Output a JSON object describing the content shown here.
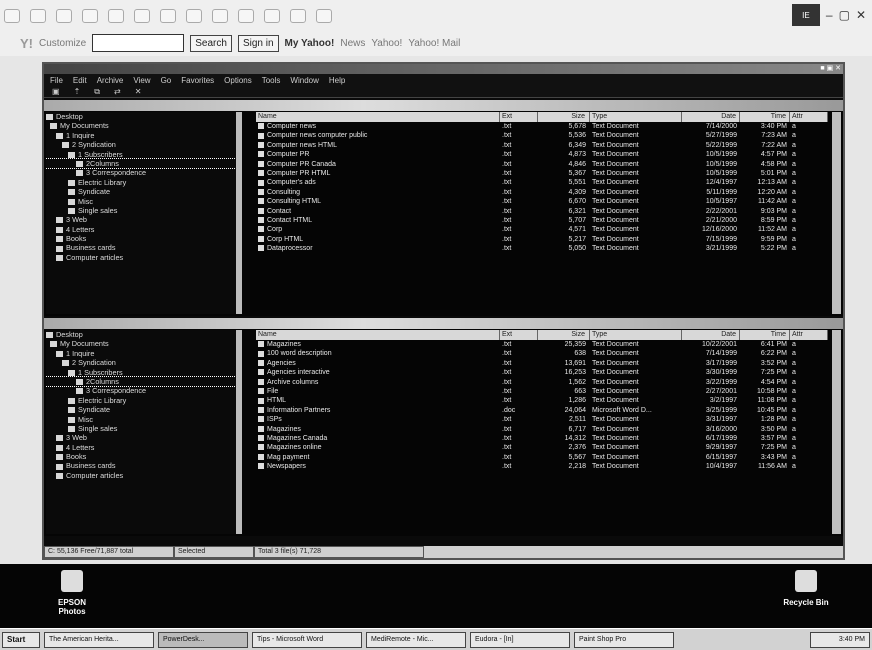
{
  "browser": {
    "search_placeholder": "",
    "customize": "Customize",
    "search_btn": "Search",
    "signin": "Sign in",
    "my_yahoo": "My Yahoo!",
    "news": "News",
    "yahoo": "Yahoo!",
    "mail": "Yahoo! Mail"
  },
  "app": {
    "title": "",
    "menu": [
      "File",
      "Edit",
      "Archive",
      "View",
      "Go",
      "Favorites",
      "Options",
      "Tools",
      "Window",
      "Help"
    ],
    "maximize_icon": "■ ▣ ✕"
  },
  "top_pane": {
    "title": "",
    "tree": [
      "Desktop",
      "My Documents",
      "1 Inquire",
      "2 Syndication",
      "1 Subscribers",
      "2Columns",
      "3 Correspondence",
      "Electric Library",
      "Syndicate",
      "Misc",
      "Single sales",
      "3 Web",
      "4 Letters",
      "Books",
      "Business cards",
      "Computer articles"
    ],
    "headers": [
      "Name",
      "Ext",
      "Size",
      "Type",
      "Date",
      "Time",
      "Attr"
    ],
    "rows": [
      [
        "Computer news",
        ".txt",
        "5,678",
        "Text Document",
        "7/14/2000",
        "3:40 PM",
        "a"
      ],
      [
        "Computer news computer public",
        ".txt",
        "5,536",
        "Text Document",
        "5/27/1999",
        "7:23 AM",
        "a"
      ],
      [
        "Computer news HTML",
        ".txt",
        "6,349",
        "Text Document",
        "5/22/1999",
        "7:22 AM",
        "a"
      ],
      [
        "Computer PR",
        ".txt",
        "4,873",
        "Text Document",
        "10/5/1999",
        "4:57 PM",
        "a"
      ],
      [
        "Computer PR Canada",
        ".txt",
        "4,846",
        "Text Document",
        "10/5/1999",
        "4:58 PM",
        "a"
      ],
      [
        "Computer PR HTML",
        ".txt",
        "5,367",
        "Text Document",
        "10/5/1999",
        "5:01 PM",
        "a"
      ],
      [
        "Computer's ads",
        ".txt",
        "5,551",
        "Text Document",
        "12/4/1997",
        "12:13 AM",
        "a"
      ],
      [
        "Consulting",
        ".txt",
        "4,309",
        "Text Document",
        "5/11/1999",
        "12:20 AM",
        "a"
      ],
      [
        "Consulting HTML",
        ".txt",
        "6,670",
        "Text Document",
        "10/5/1997",
        "11:42 AM",
        "a"
      ],
      [
        "Contact",
        ".txt",
        "6,321",
        "Text Document",
        "2/22/2001",
        "9:03 PM",
        "a"
      ],
      [
        "Contact HTML",
        ".txt",
        "5,707",
        "Text Document",
        "2/21/2000",
        "8:59 PM",
        "a"
      ],
      [
        "Corp",
        ".txt",
        "4,571",
        "Text Document",
        "12/16/2000",
        "11:52 AM",
        "a"
      ],
      [
        "Corp HTML",
        ".txt",
        "5,217",
        "Text Document",
        "7/15/1999",
        "9:59 PM",
        "a"
      ],
      [
        "Dataprocessor",
        ".txt",
        "5,050",
        "Text Document",
        "3/21/1999",
        "5:22 PM",
        "a"
      ]
    ]
  },
  "bottom_pane": {
    "title": "",
    "tree": [
      "Desktop",
      "My Documents",
      "1 Inquire",
      "2 Syndication",
      "1 Subscribers",
      "2Columns",
      "3 Correspondence",
      "Electric Library",
      "Syndicate",
      "Misc",
      "Single sales",
      "3 Web",
      "4 Letters",
      "Books",
      "Business cards",
      "Computer articles"
    ],
    "headers": [
      "Name",
      "Ext",
      "Size",
      "Type",
      "Date",
      "Time",
      "Attr"
    ],
    "rows": [
      [
        "Magazines",
        ".txt",
        "25,359",
        "Text Document",
        "10/22/2001",
        "6:41 PM",
        "a"
      ],
      [
        "100 word description",
        ".txt",
        "638",
        "Text Document",
        "7/14/1999",
        "6:22 PM",
        "a"
      ],
      [
        "Agencies",
        ".txt",
        "13,691",
        "Text Document",
        "3/17/1999",
        "3:52 PM",
        "a"
      ],
      [
        "Agencies interactive",
        ".txt",
        "16,253",
        "Text Document",
        "3/30/1999",
        "7:25 PM",
        "a"
      ],
      [
        "Archive columns",
        ".txt",
        "1,562",
        "Text Document",
        "3/22/1999",
        "4:54 PM",
        "a"
      ],
      [
        "File",
        ".txt",
        "663",
        "Text Document",
        "2/27/2001",
        "10:58 PM",
        "a"
      ],
      [
        "HTML",
        ".txt",
        "1,286",
        "Text Document",
        "3/2/1997",
        "11:08 PM",
        "a"
      ],
      [
        "Information Partners",
        ".doc",
        "24,064",
        "Microsoft Word D...",
        "3/25/1999",
        "10:45 PM",
        "a"
      ],
      [
        "ISPs",
        ".txt",
        "2,511",
        "Text Document",
        "3/31/1997",
        "1:28 PM",
        "a"
      ],
      [
        "Magazines",
        ".txt",
        "6,717",
        "Text Document",
        "3/16/2000",
        "3:50 PM",
        "a"
      ],
      [
        "Magazines Canada",
        ".txt",
        "14,312",
        "Text Document",
        "6/17/1999",
        "3:57 PM",
        "a"
      ],
      [
        "Magazines online",
        ".txt",
        "2,376",
        "Text Document",
        "9/29/1997",
        "7:25 PM",
        "a"
      ],
      [
        "Mag payment",
        ".txt",
        "5,567",
        "Text Document",
        "6/15/1997",
        "3:43 PM",
        "a"
      ],
      [
        "Newspapers",
        ".txt",
        "2,218",
        "Text Document",
        "10/4/1997",
        "11:56 AM",
        "a"
      ]
    ]
  },
  "status": [
    "C: 55,136 Free/71,887 total",
    "Selected",
    "Total 3 file(s) 71,728"
  ],
  "desktop": {
    "epson": "EPSON\nPhotos",
    "recycle": "Recycle Bin"
  },
  "taskbar": [
    "Start",
    "The American Herita...",
    "PowerDesk...",
    "Tips - Microsoft Word",
    "MediRemote - Mic...",
    "Eudora - [In]",
    "Paint Shop Pro",
    "3:40 PM"
  ]
}
